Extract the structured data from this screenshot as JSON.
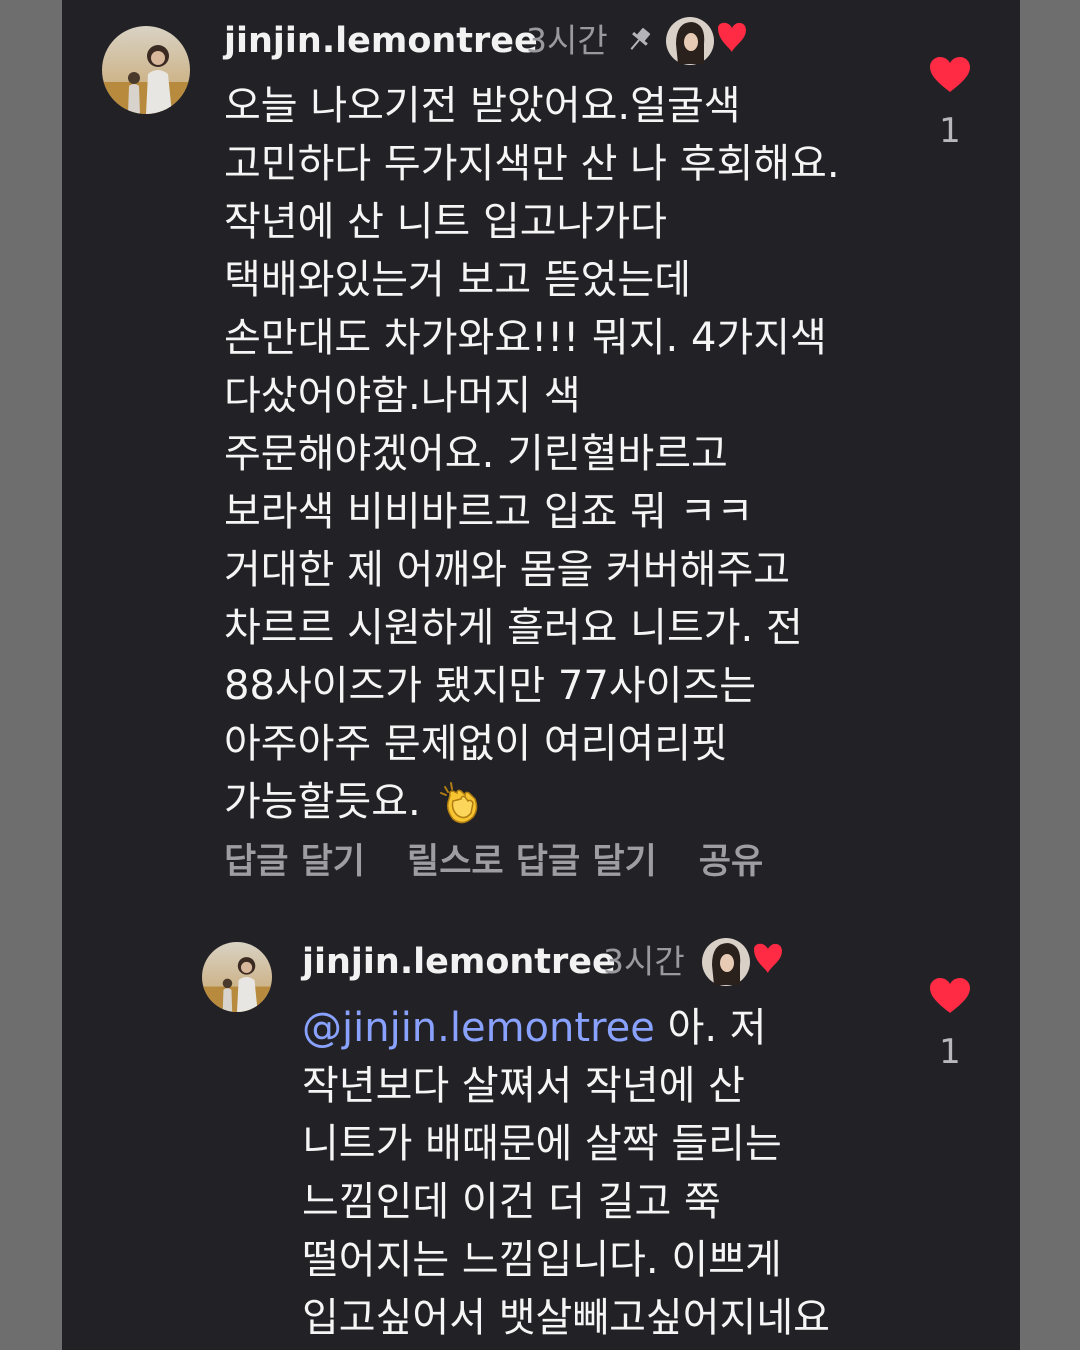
{
  "comments": [
    {
      "username": "jinjin.lemontree",
      "time": "3시간",
      "lines": [
        "오늘 나오기전 받았어요.얼굴색",
        "고민하다 두가지색만 산 나 후회해요.",
        "작년에 산 니트 입고나가다",
        "택배와있는거 보고 뜯었는데",
        "손만대도 차가와요!!! 뭐지. 4가지색",
        "다샀어야함.나머지 색",
        "주문해야겠어요. 기린혈바르고",
        "보라색 비비바르고 입죠 뭐 ㅋㅋ",
        "거대한 제 어깨와 몸을 커버해주고",
        "차르르 시원하게 흘러요 니트가. 전",
        "88사이즈가 됐지만 77사이즈는",
        "아주아주 문제없이 여리여리핏",
        "가능할듯요."
      ],
      "like_count": "1",
      "actions": [
        "답글 달기",
        "릴스로 답글 달기",
        "공유"
      ]
    },
    {
      "username": "jinjin.lemontree",
      "time": "3시간",
      "mention": "@jinjin.lemontree",
      "first_line_rest": " 아. 저",
      "lines": [
        "작년보다 살쪄서 작년에 산",
        "니트가 배때문에 살짝 들리는",
        "느낌인데 이건 더 길고 쭉",
        "떨어지는 느낌입니다. 이쁘게",
        "입고싶어서 뱃살빼고싶어지네요"
      ],
      "like_count": "1"
    }
  ],
  "colors": {
    "background": "#222226",
    "text": "#f5f5f5",
    "muted": "#9a9a9e",
    "mention": "#8aa2ff",
    "heart": "#ff2a44"
  },
  "icons": [
    "avatar",
    "pin-icon",
    "author-liked-icon",
    "heart-icon",
    "clapping-hands-emoji"
  ]
}
